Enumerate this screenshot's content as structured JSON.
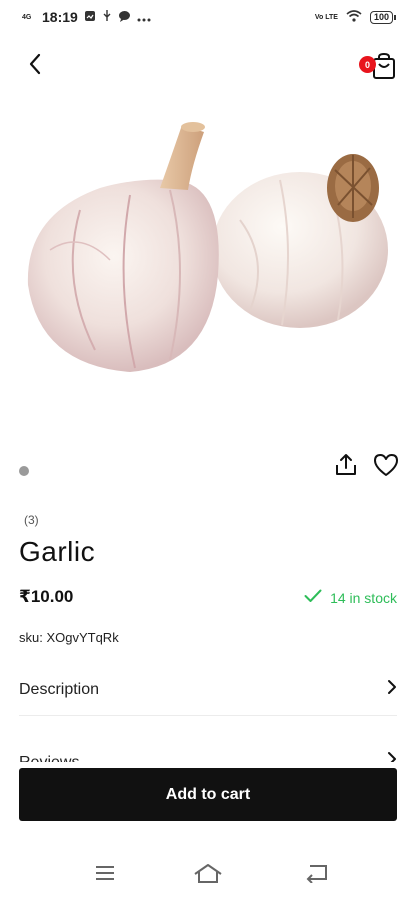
{
  "status_bar": {
    "network": "4G",
    "time": "18:19",
    "volte": "Vo LTE",
    "battery": "100"
  },
  "header": {
    "back_icon": "chevron-left-icon",
    "cart_icon": "shopping-bag-icon",
    "cart_count": "0"
  },
  "product": {
    "image": "garlic-bulbs-image",
    "review_count": "(3)",
    "name": "Garlic",
    "price": "₹10.00",
    "stock_text": "14 in stock",
    "sku_text": "sku: XOgvYTqRk"
  },
  "sections": [
    {
      "label": "Description"
    },
    {
      "label": "Reviews"
    }
  ],
  "actions": {
    "share_icon": "share-icon",
    "wishlist_icon": "heart-icon",
    "add_to_cart_label": "Add to cart"
  },
  "system_nav": {
    "menu_icon": "menu-icon",
    "home_icon": "home-icon",
    "back_icon": "back-icon"
  },
  "colors": {
    "badge": "#e8141c",
    "stock": "#2ebd59",
    "button": "#111111"
  }
}
